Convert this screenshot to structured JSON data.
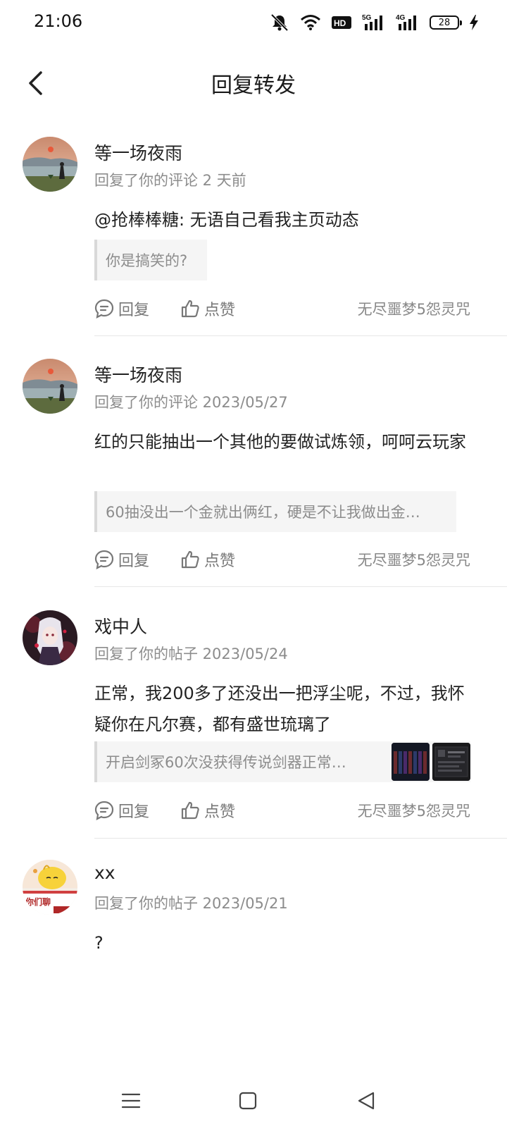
{
  "status_bar": {
    "time": "21:06",
    "battery": "28",
    "network_a": "5G",
    "network_b": "4G",
    "hd": "HD",
    "icons": [
      "mute-bell-icon",
      "wifi-icon",
      "hd-icon",
      "signal-5g-icon",
      "signal-4g-icon",
      "battery-icon",
      "charging-icon"
    ]
  },
  "header": {
    "title": "回复转发",
    "back_icon": "chevron-left-icon"
  },
  "actions": {
    "reply_label": "回复",
    "like_label": "点赞"
  },
  "items": [
    {
      "username": "等一场夜雨",
      "meta": "回复了你的评论 2 天前",
      "content": "@抢棒棒糖: 无语自己看我主页动态",
      "quote": "你是搞笑的?",
      "forum": "无尽噩梦5怨灵咒"
    },
    {
      "username": "等一场夜雨",
      "meta": "回复了你的评论 2023/05/27",
      "content": "红的只能抽出一个其他的要做试炼领，呵呵云玩家",
      "quote": "60抽没出一个金就出俩红，硬是不让我做出金…",
      "forum": "无尽噩梦5怨灵咒"
    },
    {
      "username": "戏中人",
      "meta": "回复了你的帖子 2023/05/24",
      "content": "正常，我200多了还没出一把浮尘呢，不过，我怀疑你在凡尔赛，都有盛世琉璃了",
      "quote": "开启剑冢60次没获得传说剑器正常…",
      "forum": "无尽噩梦5怨灵咒"
    },
    {
      "username": "xx",
      "meta": "回复了你的帖子 2023/05/21",
      "content": "?",
      "avatar_text": "你们聊"
    }
  ],
  "nav": {
    "icons": [
      "menu-icon",
      "home-icon",
      "back-triangle-icon"
    ]
  }
}
